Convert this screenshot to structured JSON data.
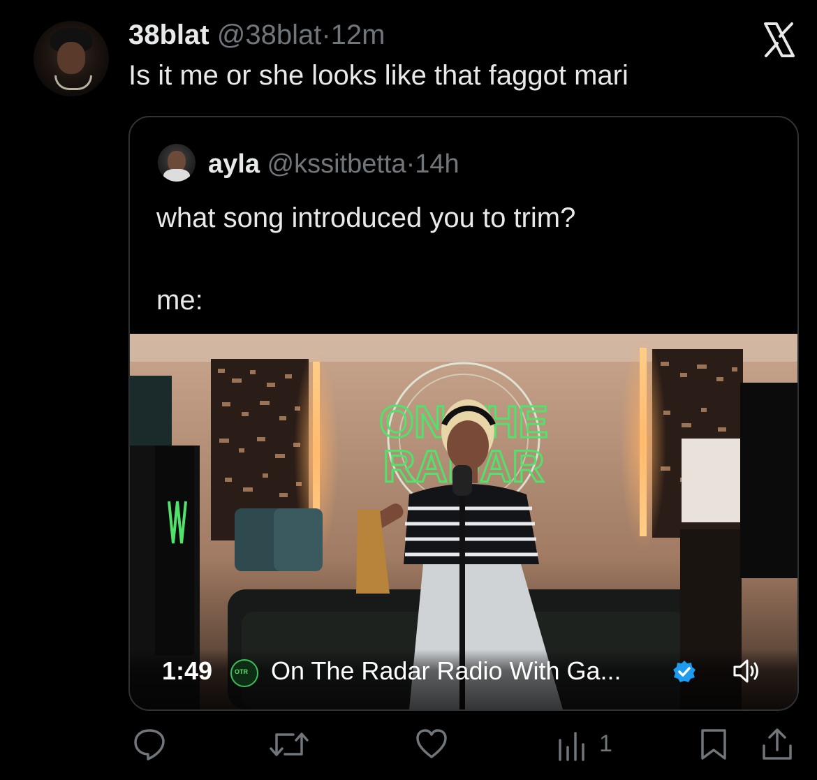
{
  "tweet": {
    "author_name": "38blat",
    "handle": "@38blat",
    "separator": "·",
    "time": "12m",
    "text": "Is it me or she looks like that faggot mari",
    "close_icon": "x-close-icon"
  },
  "quote": {
    "author_name": "ayla",
    "handle": "@kssitbetta",
    "separator": "·",
    "time": "14h",
    "text_line1": "what song introduced you to trim?",
    "text_line2": "me:",
    "video": {
      "neon_sign": [
        "ON THE",
        "RADAR"
      ],
      "duration": "1:49",
      "channel_logo_text": "OTR",
      "channel_title": "On The Radar Radio With Ga...",
      "verified_icon": "verified-badge-icon",
      "speaker_icon": "speaker-icon"
    }
  },
  "actions": {
    "reply_icon": "reply-icon",
    "repost_icon": "repost-icon",
    "like_icon": "like-icon",
    "views_icon": "views-icon",
    "views_count": "1",
    "bookmark_icon": "bookmark-icon",
    "share_icon": "share-icon"
  },
  "colors": {
    "background": "#000000",
    "primary_text": "#e7e9ea",
    "secondary_text": "#71767b",
    "border": "#2f3336",
    "verified": "#1d9bf0",
    "neon_green": "#4fe36b"
  }
}
